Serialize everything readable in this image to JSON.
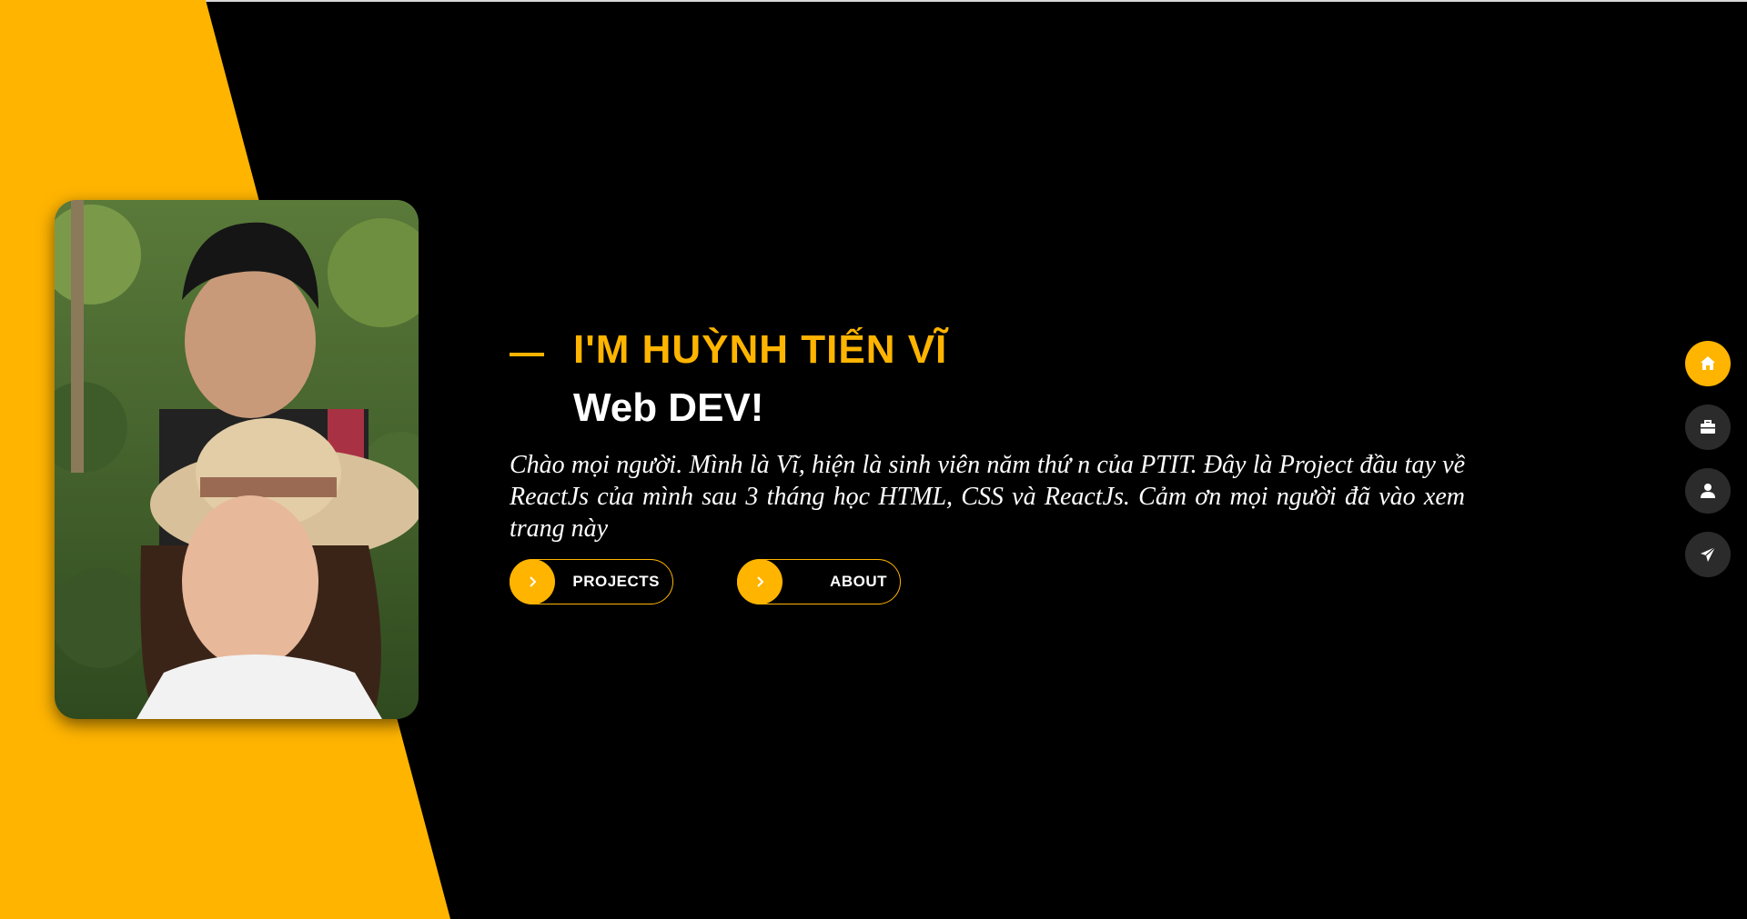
{
  "hero": {
    "greeting": "I'M HUỲNH TIẾN VĨ",
    "role": "Web DEV!",
    "intro": "Chào mọi người. Mình là Vĩ, hiện là sinh viên năm thứ n của PTIT. Đây là Project đầu tay về ReactJs của mình sau 3 tháng học HTML, CSS và ReactJs. Cảm ơn mọi người đã vào xem trang này"
  },
  "buttons": {
    "projects_label": "PROJECTS",
    "about_label": "ABOUT",
    "icon": "chevron-right-icon"
  },
  "side_nav": {
    "items": [
      {
        "icon": "home-icon",
        "active": true
      },
      {
        "icon": "briefcase-icon",
        "active": false
      },
      {
        "icon": "user-icon",
        "active": false
      },
      {
        "icon": "paper-plane-icon",
        "active": false
      }
    ]
  },
  "colors": {
    "accent": "#ffb400",
    "background": "#000000",
    "nav_inactive": "#2b2b2b",
    "text": "#ffffff"
  }
}
